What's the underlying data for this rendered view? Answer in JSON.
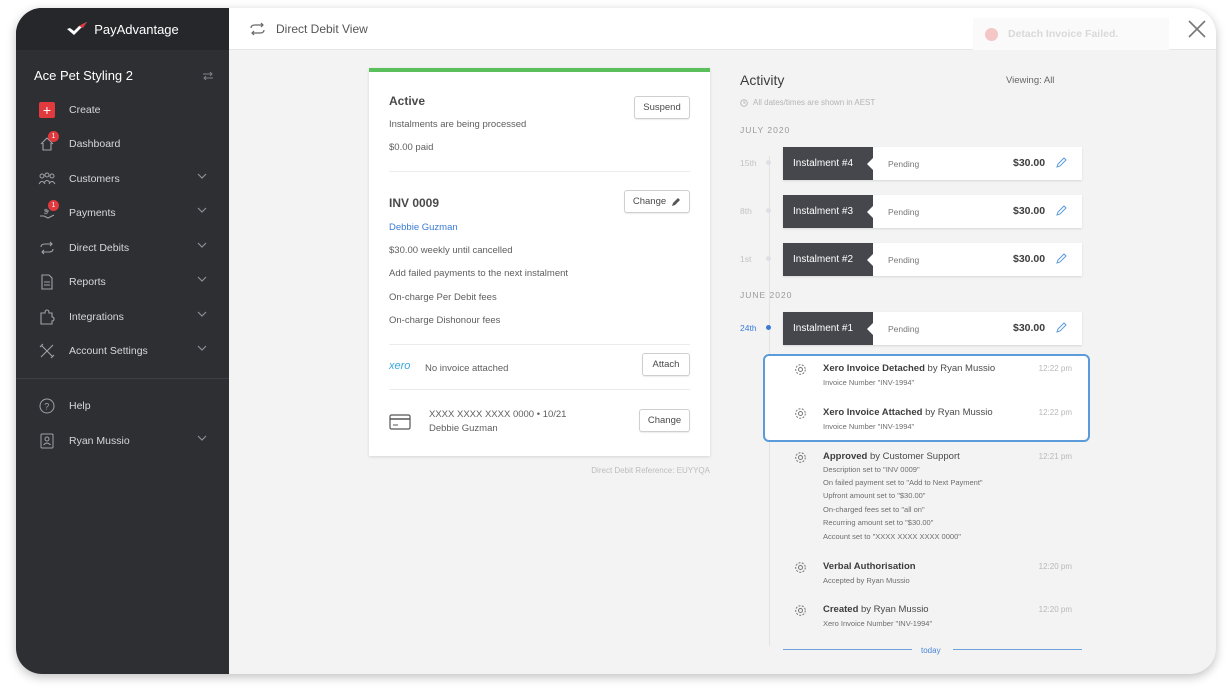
{
  "brand": {
    "name": "PayAdvantage"
  },
  "organisation": {
    "name": "Ace Pet Styling 2"
  },
  "sidebar": {
    "items": [
      {
        "label": "Create"
      },
      {
        "label": "Dashboard",
        "badge": "1"
      },
      {
        "label": "Customers"
      },
      {
        "label": "Payments",
        "badge": "1"
      },
      {
        "label": "Direct Debits"
      },
      {
        "label": "Reports"
      },
      {
        "label": "Integrations"
      },
      {
        "label": "Account Settings"
      }
    ],
    "footer": [
      {
        "label": "Help"
      },
      {
        "label": "Ryan Mussio"
      }
    ]
  },
  "topbar": {
    "title": "Direct Debit View"
  },
  "toast": {
    "text": "Detach Invoice Failed."
  },
  "status": {
    "title": "Active",
    "subtitle": "Instalments are being processed",
    "paid": "$0.00 paid",
    "suspend_label": "Suspend"
  },
  "invoice": {
    "number": "INV 0009",
    "customer": "Debbie Guzman",
    "schedule": "$30.00 weekly until cancelled",
    "failed_rule": "Add failed payments to the next instalment",
    "fee1": "On-charge Per Debit fees",
    "fee2": "On-charge Dishonour fees",
    "change_label": "Change"
  },
  "xero": {
    "logo": "xero",
    "text": "No invoice attached",
    "attach_label": "Attach"
  },
  "card_payment": {
    "number": "XXXX XXXX XXXX 0000 • 10/21",
    "name": "Debbie Guzman",
    "change_label": "Change"
  },
  "reference": "Direct Debit Reference: EUYYQA",
  "activity": {
    "title": "Activity",
    "viewing": "Viewing:  All",
    "timezone_note": "All dates/times are shown in AEST",
    "months": [
      "JULY 2020",
      "JUNE 2020"
    ],
    "instalments": [
      {
        "date": "15th",
        "label": "Instalment #4",
        "status": "Pending",
        "amount": "$30.00"
      },
      {
        "date": "8th",
        "label": "Instalment #3",
        "status": "Pending",
        "amount": "$30.00"
      },
      {
        "date": "1st",
        "label": "Instalment #2",
        "status": "Pending",
        "amount": "$30.00"
      },
      {
        "date": "24th",
        "label": "Instalment #1",
        "status": "Pending",
        "amount": "$30.00"
      }
    ],
    "events": [
      {
        "action": "Xero Invoice Detached",
        "by": " by Ryan Mussio",
        "time": "12:22 pm",
        "lines": [
          "Invoice Number \"INV-1994\""
        ]
      },
      {
        "action": "Xero Invoice Attached",
        "by": " by Ryan Mussio",
        "time": "12:22 pm",
        "lines": [
          "Invoice Number \"INV-1994\""
        ]
      },
      {
        "action": "Approved",
        "by": " by Customer Support",
        "time": "12:21 pm",
        "lines": [
          "Description set to \"INV 0009\"",
          "On failed payment set to \"Add to Next Payment\"",
          "Upfront amount set to \"$30.00\"",
          "On-charged fees set to \"all on\"",
          "Recurring amount set to \"$30.00\"",
          "Account set to \"XXXX XXXX XXXX 0000\""
        ]
      },
      {
        "action": "Verbal Authorisation",
        "by": "",
        "time": "12:20 pm",
        "lines": [
          "Accepted by Ryan Mussio"
        ]
      },
      {
        "action": "Created",
        "by": " by Ryan Mussio",
        "time": "12:20 pm",
        "lines": [
          "Xero Invoice Number \"INV-1994\""
        ]
      }
    ],
    "today_label": "today"
  },
  "colors": {
    "accent_green": "#5bbf5b",
    "link_blue": "#3a7bd5",
    "badge_red": "#e0393e",
    "highlight_blue": "#5b9bd9"
  }
}
